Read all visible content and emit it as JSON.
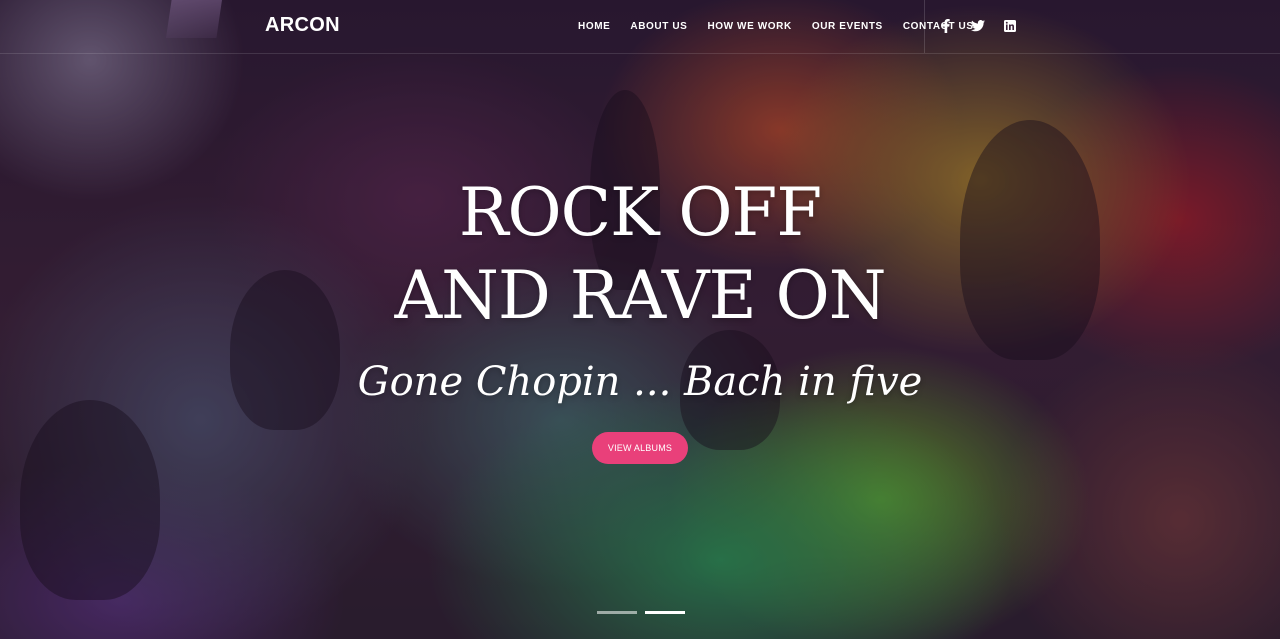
{
  "brand": {
    "logo_text": "ARCON"
  },
  "nav": {
    "items": [
      {
        "label": "HOME"
      },
      {
        "label": "ABOUT US"
      },
      {
        "label": "HOW WE WORK"
      },
      {
        "label": "OUR EVENTS"
      },
      {
        "label": "CONTACT US"
      }
    ],
    "social": [
      {
        "icon": "facebook-icon"
      },
      {
        "icon": "twitter-icon"
      },
      {
        "icon": "linkedin-icon"
      }
    ]
  },
  "hero": {
    "title_line1": "ROCK OFF",
    "title_line2": "AND RAVE ON",
    "subtitle": "Gone Chopin ... Bach in five",
    "cta_label": "VIEW ALBUMS",
    "accent_color": "#e9407a"
  },
  "slider": {
    "slides": 2,
    "active_index": 1
  }
}
